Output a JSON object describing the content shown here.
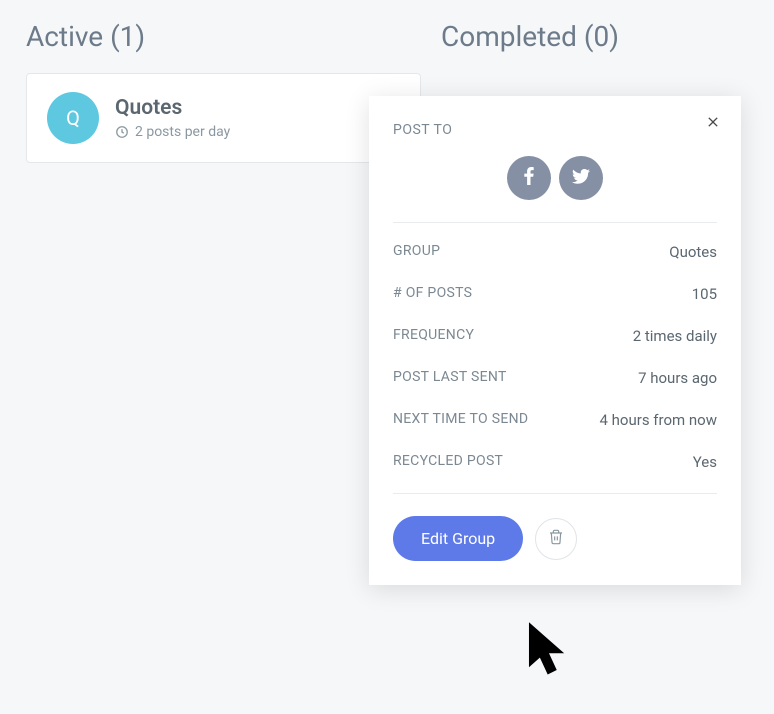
{
  "columns": {
    "active": {
      "header": "Active (1)"
    },
    "completed": {
      "header": "Completed (0)"
    }
  },
  "card": {
    "avatar_letter": "Q",
    "title": "Quotes",
    "subtitle": "2 posts per day"
  },
  "popup": {
    "post_to_label": "POST TO",
    "details": {
      "group": {
        "label": "GROUP",
        "value": "Quotes"
      },
      "posts": {
        "label": "# OF POSTS",
        "value": "105"
      },
      "frequency": {
        "label": "FREQUENCY",
        "value": "2 times daily"
      },
      "last_sent": {
        "label": "POST LAST SENT",
        "value": "7 hours ago"
      },
      "next_send": {
        "label": "NEXT TIME TO SEND",
        "value": "4 hours from now"
      },
      "recycled": {
        "label": "RECYCLED POST",
        "value": "Yes"
      }
    },
    "edit_button": "Edit Group"
  }
}
